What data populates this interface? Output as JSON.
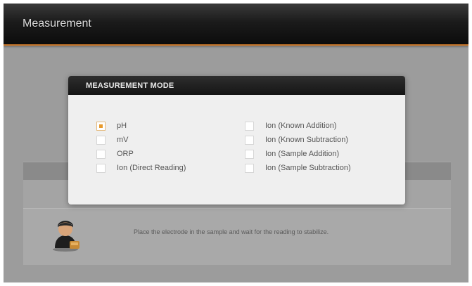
{
  "window": {
    "title": "Measurement",
    "accent": "#c8762a"
  },
  "dialog": {
    "title": "MEASUREMENT MODE",
    "selected": "pH",
    "options_left": [
      {
        "label": "pH",
        "checked": true
      },
      {
        "label": "mV",
        "checked": false
      },
      {
        "label": "ORP",
        "checked": false
      },
      {
        "label": "Ion (Direct Reading)",
        "checked": false
      }
    ],
    "options_right": [
      {
        "label": "Ion (Known Addition)",
        "checked": false
      },
      {
        "label": "Ion (Known Subtraction)",
        "checked": false
      },
      {
        "label": "Ion (Sample Addition)",
        "checked": false
      },
      {
        "label": "Ion (Sample Subtraction)",
        "checked": false
      }
    ]
  },
  "background": {
    "hint_text": "Place the electrode in the sample and wait for the reading to stabilize.",
    "avatar_icon": "operator-icon"
  },
  "colors": {
    "checked": "#e89a2c"
  }
}
